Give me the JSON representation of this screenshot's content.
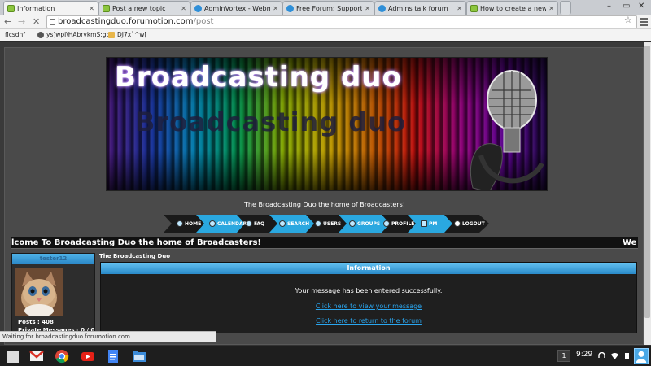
{
  "browser": {
    "tabs": [
      {
        "label": "Information",
        "icon": "forumotion-icon",
        "active": true
      },
      {
        "label": "Post a new topic",
        "icon": "forumotion-icon",
        "active": false
      },
      {
        "label": "AdminVortex - Webmast",
        "icon": "speech-bubble-icon",
        "active": false
      },
      {
        "label": "Free Forum: Support For",
        "icon": "speech-bubble-icon",
        "active": false
      },
      {
        "label": "Admins talk forum",
        "icon": "speech-bubble-icon",
        "active": false
      },
      {
        "label": "How to create a new topi",
        "icon": "forumotion-icon",
        "active": false
      }
    ],
    "url_host": "broadcastingduo.forumotion.com",
    "url_path": "/post",
    "bookmarks": [
      {
        "label": "flcsdnf",
        "icon": "page-icon"
      },
      {
        "label": "ys]wpi\\HAbrvkmS;gb",
        "icon": "globe-icon"
      },
      {
        "label": "DJ7x`^w[",
        "icon": "folder-icon"
      }
    ],
    "status_text": "Waiting for broadcastingduo.forumotion.com..."
  },
  "page": {
    "banner_title": "Broadcasting duo",
    "tagline": "The Broadcasting Duo the home of Broadcasters!",
    "nav": [
      {
        "label": "HOME"
      },
      {
        "label": "CALENDAR"
      },
      {
        "label": "FAQ"
      },
      {
        "label": "SEARCH"
      },
      {
        "label": "USERS"
      },
      {
        "label": "GROUPS"
      },
      {
        "label": "PROFILE"
      },
      {
        "label": "PM"
      },
      {
        "label": "LOGOUT"
      }
    ],
    "marquee_text": "lcome To Broadcasting Duo the home of Broadcasters!",
    "marquee_text_2": "We",
    "profile": {
      "username": "tester12",
      "posts_label": "Posts :",
      "posts_value": "408",
      "pm_label": "Private Messages :",
      "pm_value": "0 / 0"
    },
    "forum_name": "The Broadcasting Duo",
    "info": {
      "heading": "Information",
      "message": "Your message has been entered successfully.",
      "link_view": "Click here to view your message",
      "link_return": "Click here to return to the forum"
    }
  },
  "taskbar": {
    "apps": [
      "gmail-icon",
      "chrome-icon",
      "youtube-icon",
      "docs-icon",
      "files-icon"
    ],
    "notification_count": "1",
    "clock": "9:29"
  },
  "colors": {
    "accent_blue": "#2a8ac9",
    "link_blue": "#2aa6ef",
    "page_bg": "#4a4a4a"
  }
}
